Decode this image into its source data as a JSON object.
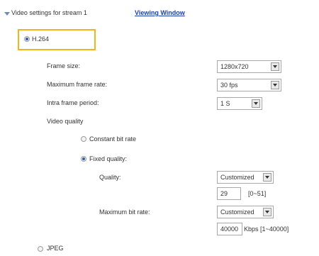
{
  "header": {
    "title": "Video settings for stream 1",
    "link": "Viewing Window"
  },
  "codecs": {
    "h264": "H.264",
    "jpeg": "JPEG"
  },
  "fields": {
    "frame_size_label": "Frame size:",
    "frame_size_value": "1280x720",
    "max_frame_rate_label": "Maximum frame rate:",
    "max_frame_rate_value": "30 fps",
    "intra_frame_label": "Intra frame period:",
    "intra_frame_value": "1 S",
    "video_quality_label": "Video quality",
    "constant_bit_rate_label": "Constant bit rate",
    "fixed_quality_label": "Fixed quality:",
    "quality_label": "Quality:",
    "quality_value": "Customized",
    "quality_input_value": "29",
    "quality_range": "[0~51]",
    "max_bit_rate_label": "Maximum bit rate:",
    "max_bit_rate_value": "Customized",
    "bit_rate_input_value": "40000",
    "bit_rate_unit": "Kbps [1~40000]"
  }
}
